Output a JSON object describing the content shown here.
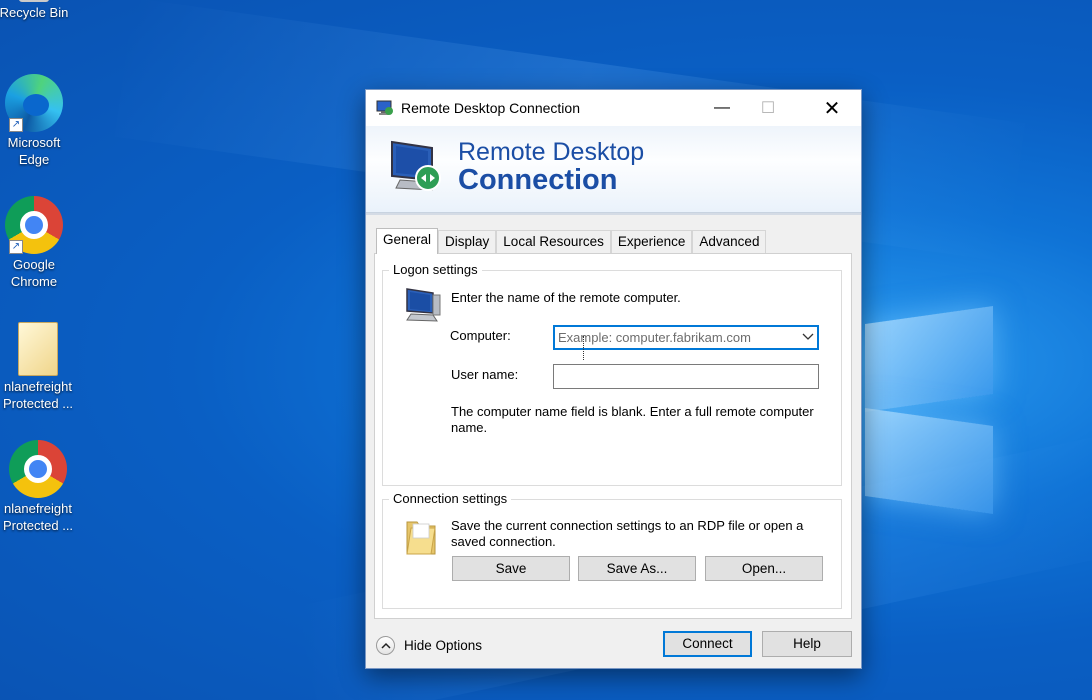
{
  "desktop": {
    "icons": [
      {
        "label_line1": "Recycle Bin",
        "label_line2": "",
        "icon": "recycle-bin-icon"
      },
      {
        "label_line1": "Microsoft",
        "label_line2": "Edge",
        "icon": "edge-icon"
      },
      {
        "label_line1": "Google",
        "label_line2": "Chrome",
        "icon": "chrome-icon"
      },
      {
        "label_line1": "nlanefreight",
        "label_line2": "Protected ...",
        "icon": "file-icon"
      },
      {
        "label_line1": "nlanefreight",
        "label_line2": "Protected ...",
        "icon": "chrome-icon"
      }
    ]
  },
  "window": {
    "title": "Remote Desktop Connection",
    "minimize": "—",
    "maximize": "☐",
    "close": "✕"
  },
  "banner": {
    "line1": "Remote Desktop",
    "line2": "Connection"
  },
  "tabs": [
    "General",
    "Display",
    "Local Resources",
    "Experience",
    "Advanced"
  ],
  "active_tab": "General",
  "logon": {
    "legend": "Logon settings",
    "instruction": "Enter the name of the remote computer.",
    "computer_label": "Computer:",
    "computer_placeholder": "Example: computer.fabrikam.com",
    "computer_value": "",
    "username_label": "User name:",
    "username_value": "",
    "warning": "The computer name field is blank. Enter a full remote computer name."
  },
  "connection": {
    "legend": "Connection settings",
    "description": "Save the current connection settings to an RDP file or open a saved connection.",
    "save_label": "Save",
    "save_as_label": "Save As...",
    "open_label": "Open..."
  },
  "footer": {
    "hide_options_label": "Hide Options",
    "connect_label": "Connect",
    "help_label": "Help"
  },
  "colors": {
    "accent": "#0078d7",
    "banner_text": "#1b4ea5",
    "desktop_bg": "#0a5fc4"
  }
}
